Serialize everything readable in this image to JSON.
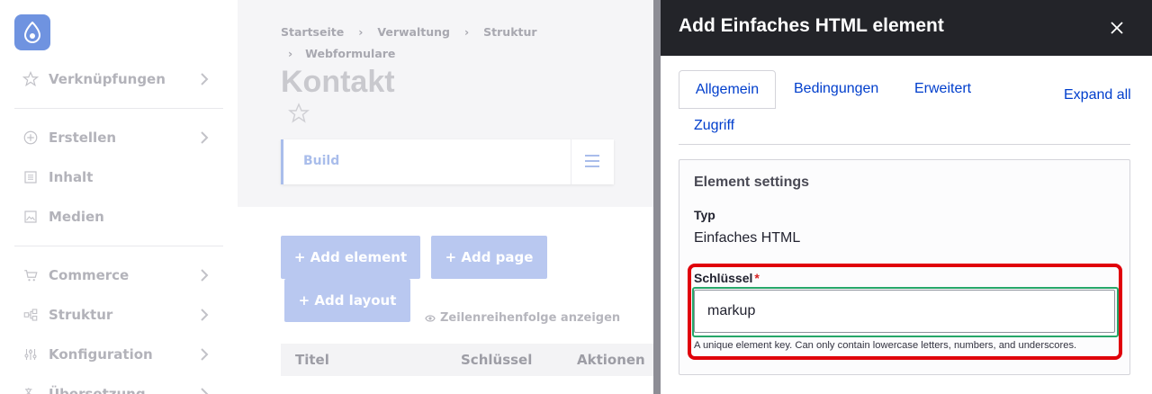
{
  "sidebar": {
    "items": [
      {
        "label": "Verknüpfungen",
        "icon": "star-icon"
      },
      {
        "label": "Erstellen",
        "icon": "plus-circle-icon"
      },
      {
        "label": "Inhalt",
        "icon": "document-icon"
      },
      {
        "label": "Medien",
        "icon": "image-icon"
      },
      {
        "label": "Commerce",
        "icon": "cart-icon"
      },
      {
        "label": "Struktur",
        "icon": "structure-icon"
      },
      {
        "label": "Konfiguration",
        "icon": "sliders-icon"
      },
      {
        "label": "Übersetzung",
        "icon": "translate-icon"
      }
    ]
  },
  "breadcrumb": [
    "Startseite",
    "Verwaltung",
    "Struktur",
    "Webformulare"
  ],
  "page": {
    "title": "Kontakt",
    "build_tab": "Build",
    "buttons": {
      "add_element": "+ Add element",
      "add_page": "+ Add page",
      "add_layout": "+ Add layout"
    },
    "row_order_link": "Zeilenreihenfolge anzeigen",
    "table_headers": [
      "Titel",
      "Schlüssel",
      "Aktionen"
    ]
  },
  "dialog": {
    "title": "Add Einfaches HTML element",
    "tabs": [
      "Allgemein",
      "Bedingungen",
      "Erweitert",
      "Zugriff"
    ],
    "expand_all": "Expand all",
    "fieldset_title": "Element settings",
    "type_label": "Typ",
    "type_value": "Einfaches HTML",
    "key_label": "Schlüssel",
    "key_required": "*",
    "key_value": "markup",
    "key_help": "A unique element key. Can only contain lowercase letters, numbers, and underscores."
  },
  "colors": {
    "dialog_header": "#232429",
    "link": "#003ecc",
    "highlight": "#e0000a",
    "focus": "#26a769"
  }
}
